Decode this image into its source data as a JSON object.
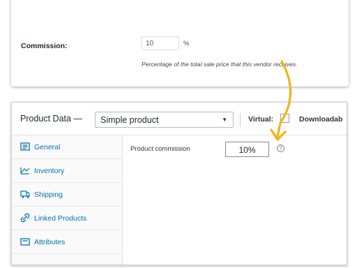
{
  "commission": {
    "label": "Commission:",
    "value": "10",
    "unit": "%",
    "description": "Percentage of the total sale price that this vendor receives."
  },
  "product_data": {
    "title": "Product Data —",
    "type_selected": "Simple product",
    "virtual_label": "Virtual:",
    "downloadable_label": "Downloadab",
    "tabs": [
      {
        "label": "General",
        "icon": "general-icon"
      },
      {
        "label": "Inventory",
        "icon": "inventory-icon"
      },
      {
        "label": "Shipping",
        "icon": "truck-icon"
      },
      {
        "label": "Linked Products",
        "icon": "link-icon"
      },
      {
        "label": "Attributes",
        "icon": "attributes-icon"
      }
    ],
    "product_commission_label": "Product commission",
    "product_commission_value": "10%",
    "help_glyph": "?"
  },
  "colors": {
    "accent_arrow": "#f2b21a",
    "link": "#0073aa"
  }
}
